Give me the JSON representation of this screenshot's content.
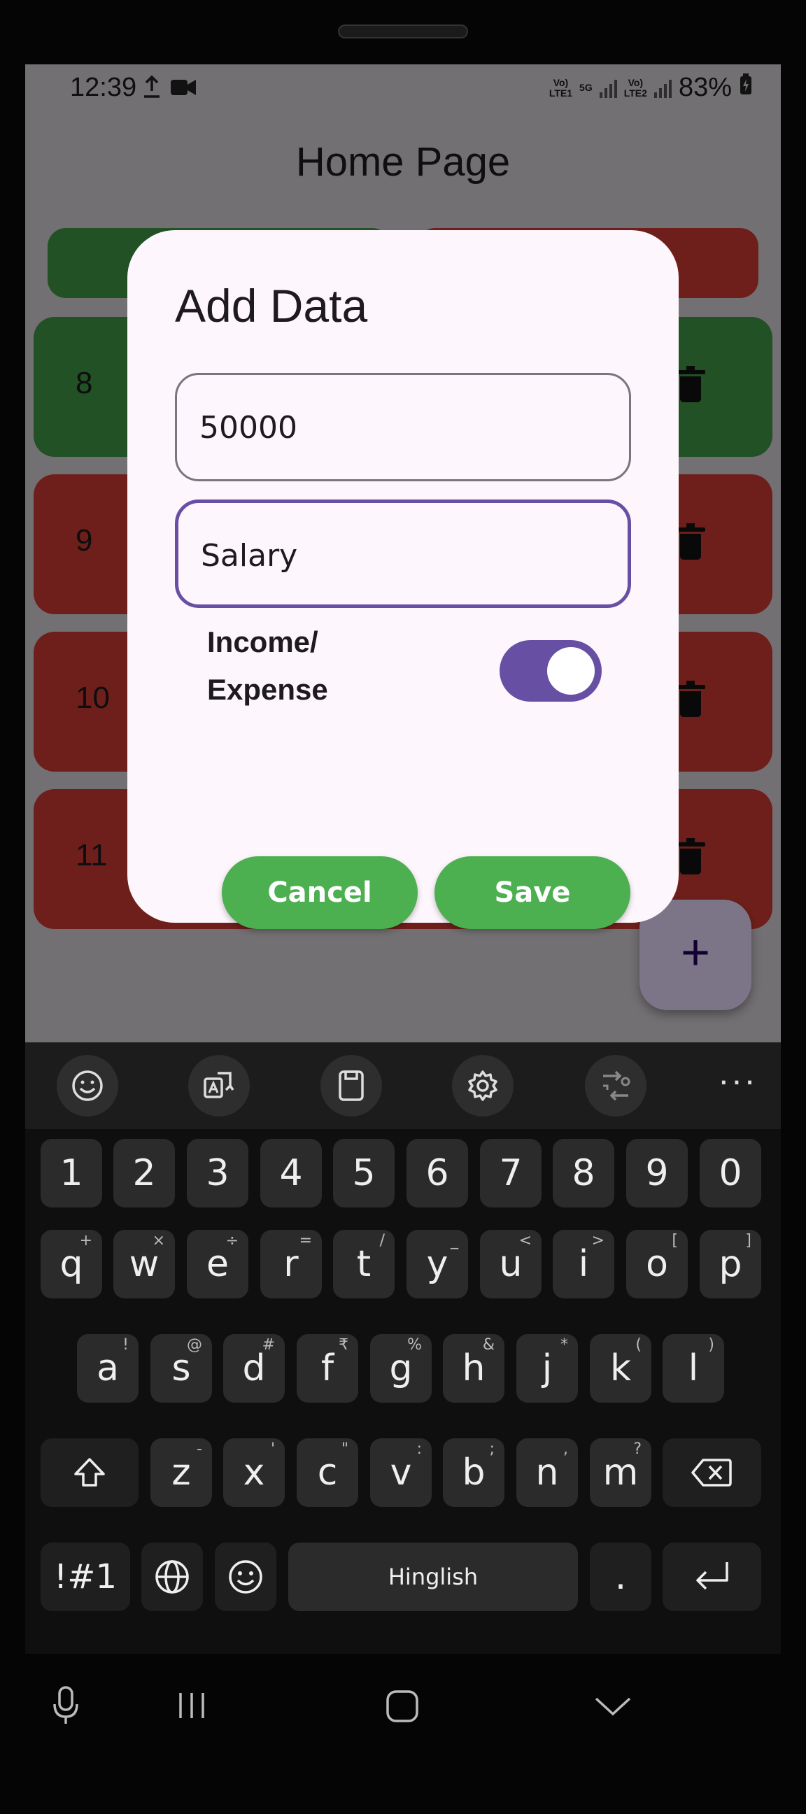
{
  "status_bar": {
    "time": "12:39",
    "net1": "Vo)\nLTE1",
    "net_5g": "5G",
    "net2": "Vo)\nLTE2",
    "battery": "83%"
  },
  "app": {
    "title": "Home Page",
    "rows": [
      {
        "id": "8",
        "color": "#3f9a47"
      },
      {
        "id": "9",
        "color": "#d23c33"
      },
      {
        "id": "10",
        "color": "#d23c33"
      },
      {
        "id": "11",
        "color": "#d23c33"
      }
    ],
    "fab_label": "+"
  },
  "dialog": {
    "title": "Add Data",
    "amount_value": "50000",
    "name_value": "Salary",
    "switch_label": "Income/ Expense",
    "switch_on": true,
    "cancel_label": "Cancel",
    "save_label": "Save"
  },
  "keyboard": {
    "toolbar": [
      "emoji-icon",
      "translate-icon",
      "clipboard-icon",
      "settings-icon",
      "text-convert-icon",
      "more-icon"
    ],
    "number_row": [
      "1",
      "2",
      "3",
      "4",
      "5",
      "6",
      "7",
      "8",
      "9",
      "0"
    ],
    "row1": [
      {
        "key": "q",
        "hint": "+"
      },
      {
        "key": "w",
        "hint": "×"
      },
      {
        "key": "e",
        "hint": "÷"
      },
      {
        "key": "r",
        "hint": "="
      },
      {
        "key": "t",
        "hint": "/"
      },
      {
        "key": "y",
        "hint": "_"
      },
      {
        "key": "u",
        "hint": "<"
      },
      {
        "key": "i",
        "hint": ">"
      },
      {
        "key": "o",
        "hint": "["
      },
      {
        "key": "p",
        "hint": "]"
      }
    ],
    "row2": [
      {
        "key": "a",
        "hint": "!"
      },
      {
        "key": "s",
        "hint": "@"
      },
      {
        "key": "d",
        "hint": "#"
      },
      {
        "key": "f",
        "hint": "₹"
      },
      {
        "key": "g",
        "hint": "%"
      },
      {
        "key": "h",
        "hint": "&"
      },
      {
        "key": "j",
        "hint": "*"
      },
      {
        "key": "k",
        "hint": "("
      },
      {
        "key": "l",
        "hint": ")"
      }
    ],
    "row3": [
      {
        "key": "z",
        "hint": "-"
      },
      {
        "key": "x",
        "hint": "'"
      },
      {
        "key": "c",
        "hint": "\""
      },
      {
        "key": "v",
        "hint": ":"
      },
      {
        "key": "b",
        "hint": ";"
      },
      {
        "key": "n",
        "hint": ","
      },
      {
        "key": "m",
        "hint": "?"
      }
    ],
    "symbols_label": "!#1",
    "space_label": "Hinglish",
    "period_label": "."
  },
  "colors": {
    "accent": "#6750a4",
    "button_green": "#4caf50",
    "income_green": "#3f9a47",
    "expense_red": "#d23c33"
  }
}
